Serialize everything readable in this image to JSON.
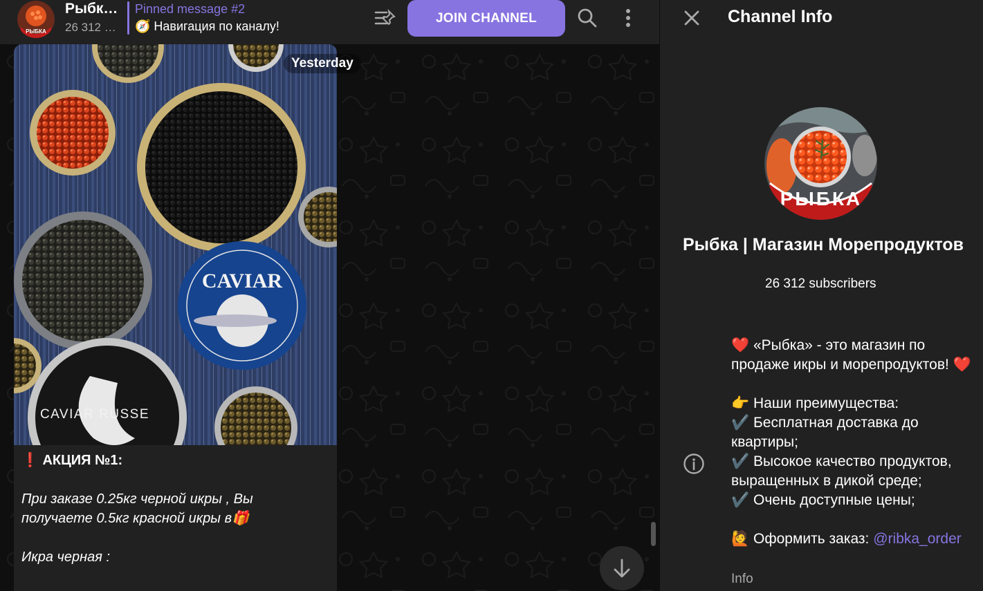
{
  "header": {
    "title": "Рыбк…",
    "subscribers_short": "26 312 …",
    "pinned_title": "Pinned message #2",
    "pinned_text": "🧭 Навигация по каналу!",
    "join_label": "JOIN CHANNEL",
    "avatar_text": "РЫБКА"
  },
  "message": {
    "date": "Yesterday",
    "lines": [
      "❗ АКЦИЯ №1:",
      "",
      "При заказе 0.25кг черной икры , Вы",
      "получаете 0.5кг красной икры в🎁",
      "",
      "Икра черная :"
    ],
    "photo_label_caviar": "CAVIAR",
    "photo_label_caviar_russe": "CAVIAR RUSSE"
  },
  "info_panel": {
    "title": "Channel Info",
    "avatar_text": "РЫБКА",
    "channel_name": "Рыбка | Магазин Морепродуктов",
    "subscribers": "26 312 subscribers",
    "description": {
      "intro": "❤️ «Рыбка» - это магазин по продаже икры и морепродуктов! ❤️",
      "advantages_title": "👉 Наши преимущества:",
      "adv1": "✔️ Бесплатная доставка до квартиры;",
      "adv2": "✔️ Высокое качество продуктов, выращенных в дикой среде;",
      "adv3": "✔️ Очень доступные цены;",
      "order_prefix": "🙋 Оформить заказ: ",
      "order_link": "@ribka_order"
    },
    "description_label": "Info"
  },
  "colors": {
    "accent": "#8774e1",
    "panel_bg": "#212121",
    "chat_bg": "#0f0f0f"
  }
}
